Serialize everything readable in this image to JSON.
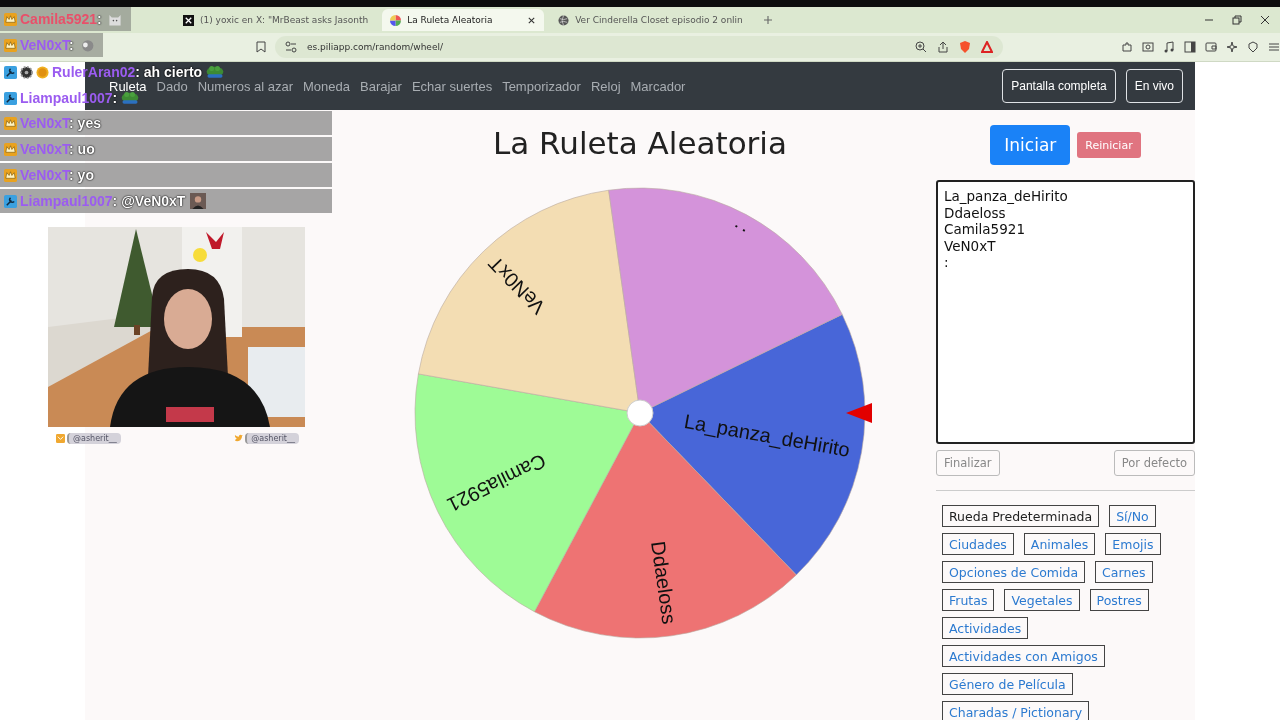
{
  "browser": {
    "tabs": [
      {
        "title": "(1) yoxic en X: \"MrBeast asks Jasonth",
        "selected": false,
        "kind": "x"
      },
      {
        "title": "La Ruleta Aleatoria",
        "selected": true,
        "kind": "wheel"
      },
      {
        "title": "Ver Cinderella Closet episodio 2 onlin",
        "selected": false,
        "kind": "globe"
      }
    ],
    "url": "es.piliapp.com/random/wheel/"
  },
  "chat": [
    {
      "badges": [
        {
          "kind": "crown"
        }
      ],
      "username": "Camila5921",
      "color": "#e8506a",
      "message": ":",
      "emote": {
        "kind": "cat"
      }
    },
    {
      "badges": [
        {
          "kind": "crown"
        }
      ],
      "username": "VeN0xT",
      "color": "#9b5cf0",
      "message": ":",
      "emote": {
        "kind": "seal"
      }
    },
    {
      "badges": [
        {
          "kind": "wrench"
        },
        {
          "kind": "gear"
        },
        {
          "kind": "coin"
        }
      ],
      "username": "RulerAran02",
      "color": "#9b5cf0",
      "message": ": ah cierto",
      "emote": {
        "kind": "frog"
      }
    },
    {
      "badges": [
        {
          "kind": "wrench"
        }
      ],
      "username": "Liampaul1007",
      "color": "#9b5cf0",
      "message": ":",
      "emote": {
        "kind": "frog"
      }
    },
    {
      "badges": [
        {
          "kind": "crown"
        }
      ],
      "username": "VeN0xT",
      "color": "#9b5cf0",
      "message": ": yes"
    },
    {
      "badges": [
        {
          "kind": "crown"
        }
      ],
      "username": "VeN0xT",
      "color": "#9b5cf0",
      "message": ": uo"
    },
    {
      "badges": [
        {
          "kind": "crown"
        }
      ],
      "username": "VeN0xT",
      "color": "#9b5cf0",
      "message": ": yo"
    },
    {
      "badges": [
        {
          "kind": "wrench"
        }
      ],
      "username": "Liampaul1007",
      "color": "#9b5cf0",
      "message": ": @VeN0xT",
      "emote": {
        "kind": "person"
      }
    }
  ],
  "webcam": {
    "handles": [
      {
        "kind": "mail",
        "text": "@asherit__"
      },
      {
        "kind": "bird",
        "text": "@asherit__"
      }
    ]
  },
  "nav": {
    "items": [
      {
        "label": "Ruleta",
        "selected": true
      },
      {
        "label": "Dado",
        "selected": false
      },
      {
        "label": "Numeros al azar",
        "selected": false
      },
      {
        "label": "Moneda",
        "selected": false
      },
      {
        "label": "Barajar",
        "selected": false
      },
      {
        "label": "Echar suertes",
        "selected": false
      },
      {
        "label": "Temporizador",
        "selected": false
      },
      {
        "label": "Reloj",
        "selected": false
      },
      {
        "label": "Marcador",
        "selected": false
      }
    ],
    "buttons": [
      "Pantalla completa",
      "En vivo"
    ]
  },
  "title": "La Ruleta Aleatoria",
  "wheel": {
    "segments": [
      {
        "label": "La_panza_deHirito",
        "color": "#4866d8"
      },
      {
        "label": "Ddaeloss",
        "color": "#ee7373"
      },
      {
        "label": "Camila5921",
        "color": "#9efb96"
      },
      {
        "label": "VeN0xT",
        "color": "#f3ddb3"
      },
      {
        "label": ":",
        "color": "#d493da"
      }
    ]
  },
  "start_button": "Iniciar",
  "reset_button": "Reiniciar",
  "names_field": {
    "lines": [
      "La_panza_deHirito",
      "Ddaeloss",
      "Camila5921",
      "VeN0xT",
      ":"
    ]
  },
  "finish_button": "Finalizar",
  "default_button": "Por defecto",
  "presets": [
    {
      "label": "Rueda Predeterminada",
      "selected": true
    },
    {
      "label": "Sí/No",
      "selected": false
    },
    {
      "label": "Ciudades",
      "selected": false
    },
    {
      "label": "Animales",
      "selected": false
    },
    {
      "label": "Emojis",
      "selected": false
    },
    {
      "label": "Opciones de Comida",
      "selected": false
    },
    {
      "label": "Carnes",
      "selected": false
    },
    {
      "label": "Frutas",
      "selected": false
    },
    {
      "label": "Vegetales",
      "selected": false
    },
    {
      "label": "Postres",
      "selected": false
    },
    {
      "label": "Actividades",
      "selected": false
    },
    {
      "label": "Actividades con Amigos",
      "selected": false
    },
    {
      "label": "Género de Película",
      "selected": false
    },
    {
      "label": "Charadas / Pictionary",
      "selected": false
    }
  ]
}
